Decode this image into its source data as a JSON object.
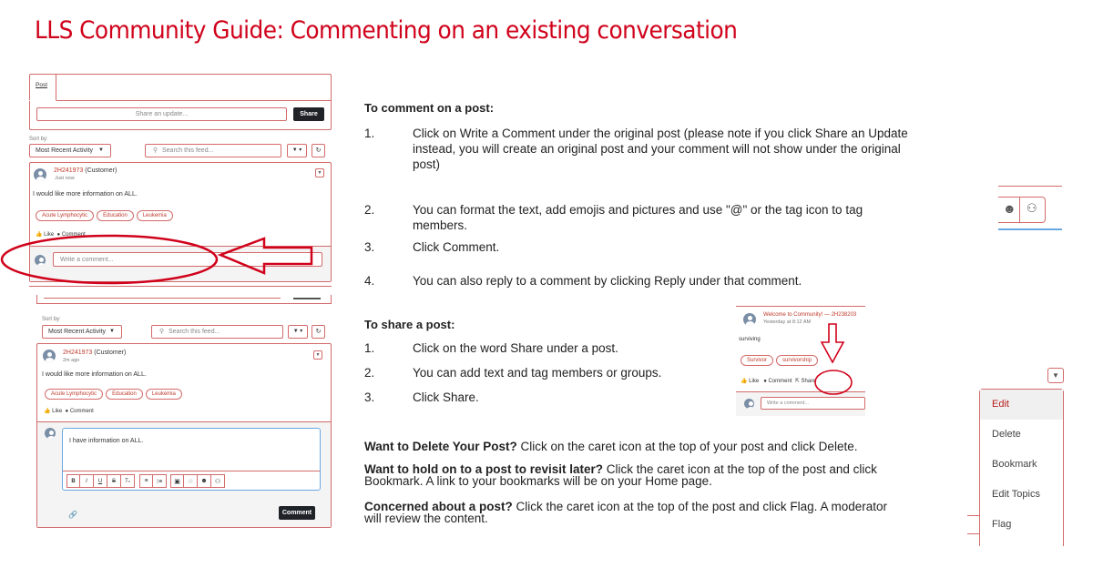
{
  "title": "LLS Community Guide: Commenting on an existing conversation",
  "colors": {
    "accent": "#d0021b",
    "panel_border": "#d46a6a",
    "dark_button": "#1f2328"
  },
  "screenshot1": {
    "tab": "Post",
    "share_placeholder": "Share an update...",
    "share_button": "Share",
    "sort_label": "Sort by:",
    "sort_value": "Most Recent Activity",
    "search_placeholder": "Search this feed...",
    "author": "2H241973",
    "role": "(Customer)",
    "time": "Just now",
    "body": "I would like more information on ALL.",
    "topics": [
      "Acute Lymphocytic",
      "Education",
      "Leukemia"
    ],
    "like": "Like",
    "comment": "Comment",
    "comment_placeholder": "Write a comment..."
  },
  "screenshot2": {
    "sort_label": "Sort by:",
    "sort_value": "Most Recent Activity",
    "search_placeholder": "Search this feed...",
    "author": "2H241973",
    "role": "(Customer)",
    "time": "2m ago",
    "body": "I would like more information on ALL.",
    "topics": [
      "Acute Lymphocytic",
      "Education",
      "Leukemia"
    ],
    "like": "Like",
    "comment": "Comment",
    "comment_value": "I have information on ALL.",
    "toolbar": [
      "B",
      "I",
      "U",
      "S",
      "Tx",
      "list",
      "numbered-list",
      "image",
      "link",
      "emoji",
      "mention"
    ],
    "comment_button": "Comment"
  },
  "screenshot3": {
    "title": "Welcome to Community! — 2H238203",
    "time": "Yesterday at 8:12 AM",
    "body": "surviving",
    "topics": [
      "Survivor",
      "survivorship"
    ],
    "like": "Like",
    "comment": "Comment",
    "share": "Share",
    "comment_placeholder": "Write a comment..."
  },
  "menu": {
    "items": [
      "Edit",
      "Delete",
      "Bookmark",
      "Edit Topics",
      "Flag"
    ]
  },
  "comment_section": {
    "heading": "To comment on a post:",
    "steps": [
      {
        "num": "1.",
        "lines": [
          "Click on Write a Comment under the original post (please note if you click Share an Update",
          "instead, you will create an original post and your comment will not show under the original",
          "post)"
        ]
      },
      {
        "num": "2.",
        "lines": [
          "You can format the text, add emojis and pictures and use \"@\" or the tag icon  to tag",
          "members."
        ]
      },
      {
        "num": "3.",
        "lines": [
          "Click Comment."
        ]
      },
      {
        "num": "4.",
        "lines": [
          "You can also reply to a comment by clicking Reply under that comment."
        ]
      }
    ]
  },
  "share_section": {
    "heading": "To share a post:",
    "steps": [
      {
        "num": "1.",
        "text": "Click on the word Share under a post."
      },
      {
        "num": "2.",
        "text": "You can add text and tag members or groups."
      },
      {
        "num": "3.",
        "text": "Click Share."
      }
    ]
  },
  "tips": [
    {
      "bold": "Want to Delete Your Post?",
      "lines": [
        " Click on the caret icon at the top of your post and click Delete."
      ]
    },
    {
      "bold": "Want to hold on to a post to revisit later?",
      "lines": "  Click the caret icon at the top of the post and click|Bookmark.  A link to your bookmarks will be on your Home page."
    },
    {
      "bold": "Concerned about a post?",
      "lines": " Click the caret icon at the top of the post and click Flag.  A moderator|will review the content."
    }
  ],
  "tips_text": {
    "t0_rest": " Click on the caret icon at the top of your post and click Delete.",
    "t1_rest1": "  Click the caret icon at the top of the post and click",
    "t1_rest2": "Bookmark.  A link to your bookmarks will be on your Home page.",
    "t2_rest1": " Click the caret icon at the top of the post and click Flag.  A moderator",
    "t2_rest2": "will review the content."
  }
}
